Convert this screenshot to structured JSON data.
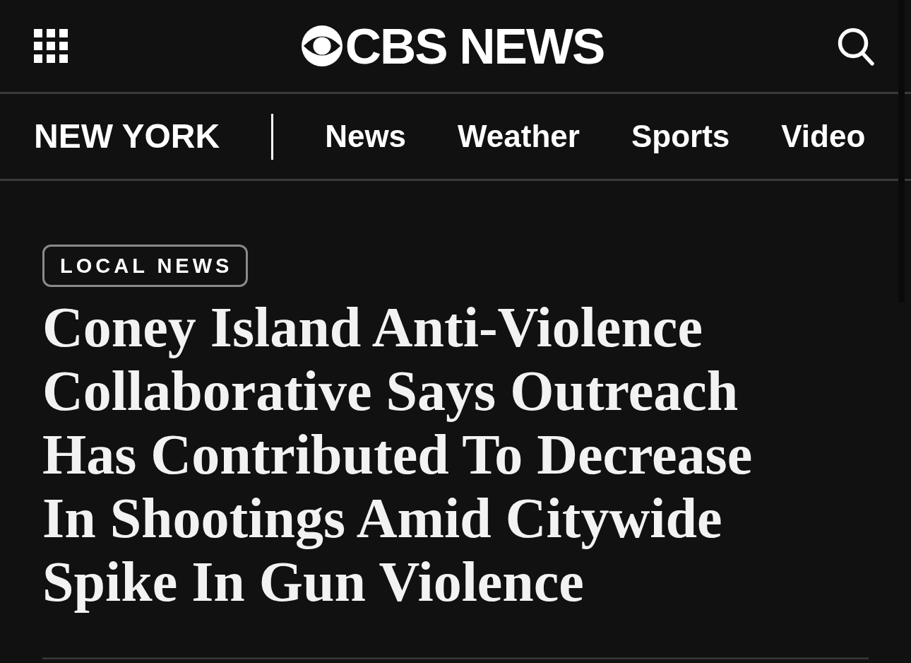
{
  "header": {
    "logo": {
      "text": "CBS NEWS"
    }
  },
  "section_nav": {
    "title": "NEW YORK",
    "links": [
      {
        "label": "News"
      },
      {
        "label": "Weather"
      },
      {
        "label": "Sports"
      },
      {
        "label": "Video"
      }
    ]
  },
  "article": {
    "category": "LOCAL NEWS",
    "headline": "Coney Island Anti-Violence Collaborative Says Outreach Has Contributed To Decrease In Shootings Amid Citywide Spike In Gun Violence"
  }
}
